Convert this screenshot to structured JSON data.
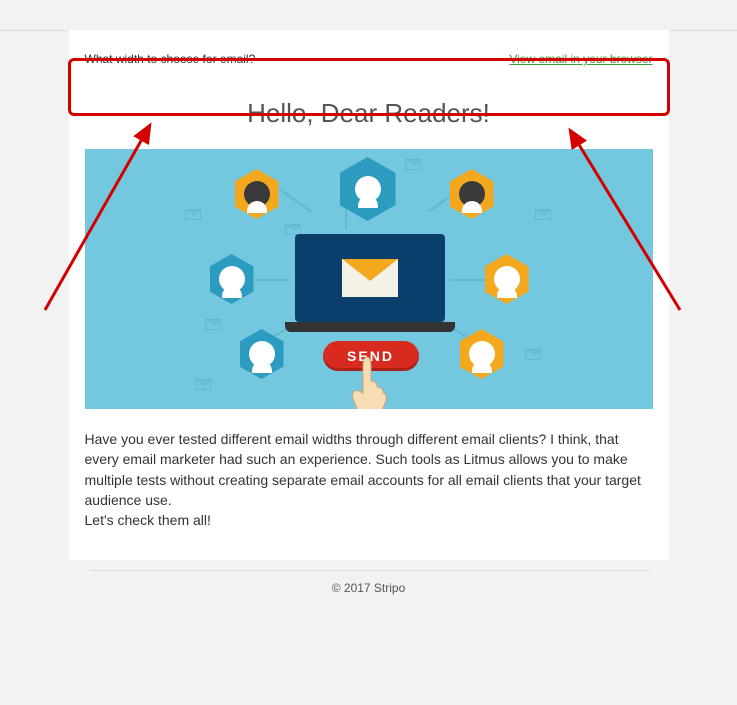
{
  "preheader": {
    "left_text": "What width to choose for email?",
    "right_link_text": "View email in your browser"
  },
  "headline": "Hello, Dear Readers!",
  "hero": {
    "send_button_label": "SEND"
  },
  "body": {
    "paragraph1": "Have you ever tested different email widths through different email clients? I think, that every email marketer had such an experience. Such tools as Litmus allows you to make multiple tests without creating separate email accounts for all email clients that your target audience use.",
    "paragraph2": "Let's check them all!"
  },
  "footer": {
    "copyright": "© 2017 Stripo"
  }
}
